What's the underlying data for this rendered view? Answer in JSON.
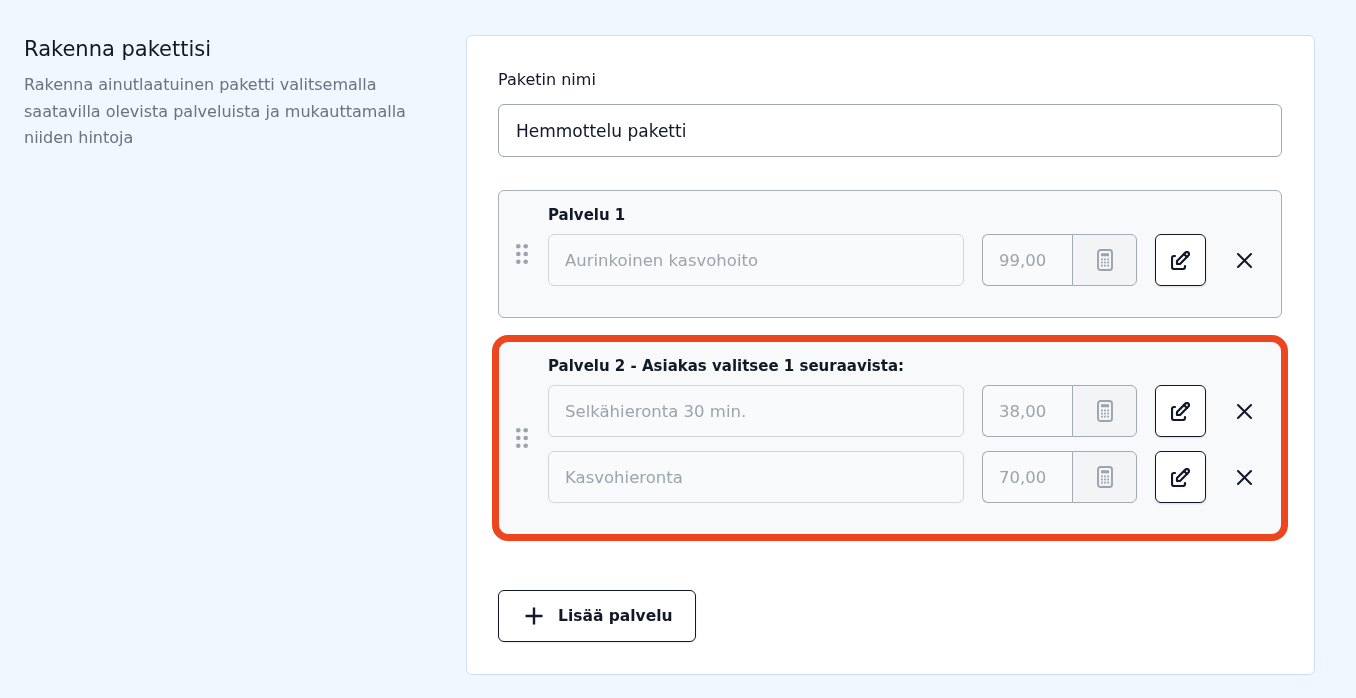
{
  "intro": {
    "title": "Rakenna pakettisi",
    "description": "Rakenna ainutlaatuinen paketti valitsemalla saatavilla olevista palveluista ja mukauttamalla niiden hintoja"
  },
  "form": {
    "name_field": {
      "label": "Paketin nimi",
      "value": "Hemmottelu paketti"
    },
    "services": [
      {
        "title": "Palvelu 1",
        "highlighted": false,
        "items": [
          {
            "name": "Aurinkoinen kasvohoito",
            "price": "99,00",
            "disabled": true
          }
        ]
      },
      {
        "title": "Palvelu 2 - Asiakas valitsee 1 seuraavista:",
        "highlighted": true,
        "items": [
          {
            "name": "Selkähieronta 30 min.",
            "price": "38,00",
            "disabled": true
          },
          {
            "name": "Kasvohieronta",
            "price": "70,00",
            "disabled": true
          }
        ]
      }
    ],
    "add_button": {
      "label": "Lisää palvelu"
    }
  }
}
